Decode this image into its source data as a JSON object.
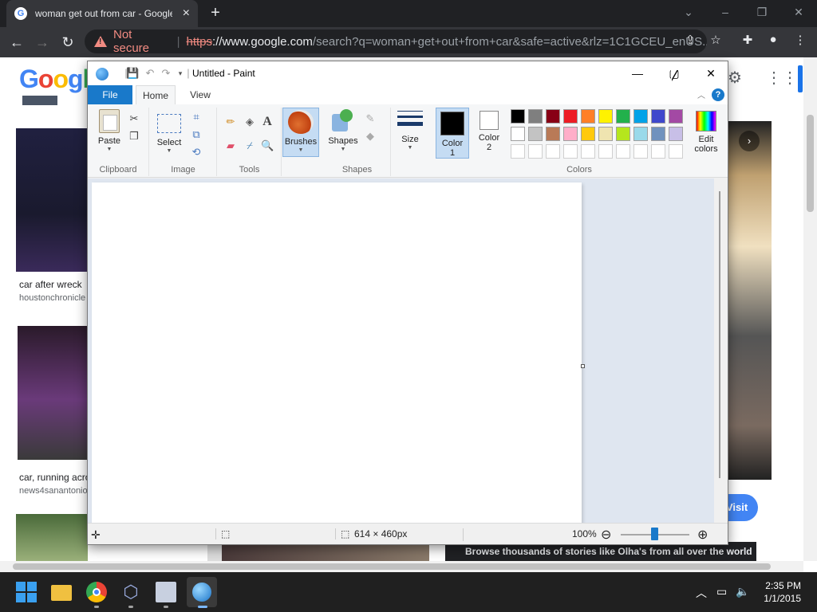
{
  "browser": {
    "tab_title": "woman get out from car - Google Search",
    "new_tab": "+",
    "address": {
      "security_label": "Not secure",
      "scheme": "https",
      "host": "://www.google.com",
      "path": "/search?q=woman+get+out+from+car&safe=active&rlz=1C1GCEU_enUS..."
    },
    "logo": "Google"
  },
  "google_page": {
    "results": [
      {
        "title": "car after wreck",
        "source": "houstonchronicle"
      },
      {
        "title": "car, running acro",
        "source": "news4sanantonio"
      }
    ],
    "visit_button": "Visit",
    "banner": "Browse thousands of stories like Olha's from all over the world"
  },
  "paint": {
    "window_title": "Untitled - Paint",
    "tabs": {
      "file": "File",
      "home": "Home",
      "view": "View"
    },
    "groups": {
      "clipboard": "Clipboard",
      "image": "Image",
      "tools": "Tools",
      "shapes": "Shapes",
      "colors": "Colors"
    },
    "buttons": {
      "paste": "Paste",
      "select": "Select",
      "brushes": "Brushes",
      "shapes": "Shapes",
      "size": "Size",
      "color1_a": "Color",
      "color1_b": "1",
      "color2_a": "Color",
      "color2_b": "2",
      "edit_a": "Edit",
      "edit_b": "colors"
    },
    "palette_row1": [
      "#000000",
      "#7f7f7f",
      "#880015",
      "#ed1c24",
      "#ff7f27",
      "#fff200",
      "#22b14c",
      "#00a2e8",
      "#3f48cc",
      "#a349a4"
    ],
    "palette_row2": [
      "#ffffff",
      "#c3c3c3",
      "#b97a57",
      "#ffaec9",
      "#ffc90e",
      "#efe4b0",
      "#b5e61d",
      "#99d9ea",
      "#7092be",
      "#c8bfe7"
    ],
    "status": {
      "canvas_size": "614 × 460px",
      "zoom": "100%"
    }
  },
  "taskbar": {
    "time": "2:35 PM",
    "date": "1/1/2015"
  }
}
